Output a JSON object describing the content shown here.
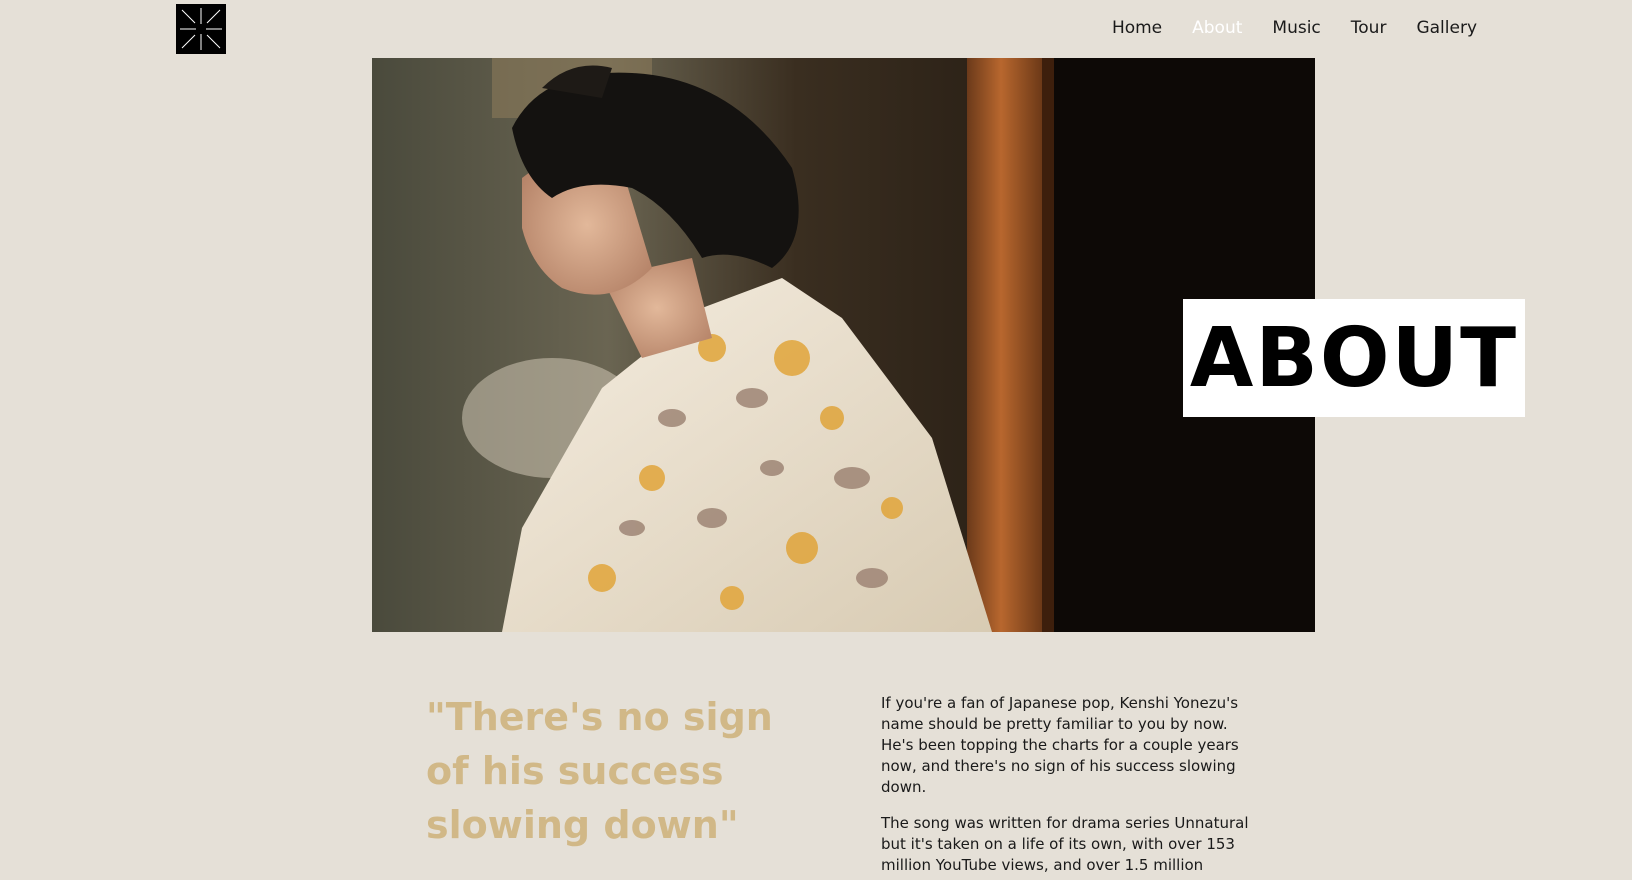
{
  "header": {
    "logo_icon": "kenshi-logo-icon",
    "nav": [
      {
        "label": "Home",
        "active": false
      },
      {
        "label": "About",
        "active": true
      },
      {
        "label": "Music",
        "active": false
      },
      {
        "label": "Tour",
        "active": false
      },
      {
        "label": "Gallery",
        "active": false
      }
    ]
  },
  "hero": {
    "section_title": "ABOUT"
  },
  "content": {
    "quote": "\"There's no sign of his success slowing down\"",
    "paragraphs": [
      "If you're a fan of Japanese pop, Kenshi Yonezu's name should be pretty familiar to you by now. He's been topping the charts for a couple years now, and there's no sign of his success slowing down.",
      "The song was written for drama series Unnatural but it's taken on a life of its own, with over 153 million YouTube views, and over 1.5 million"
    ]
  },
  "colors": {
    "background": "#e5e0d7",
    "accent_quote": "#d1b887",
    "nav_active": "#ffffff",
    "text": "#1a1a1a"
  }
}
